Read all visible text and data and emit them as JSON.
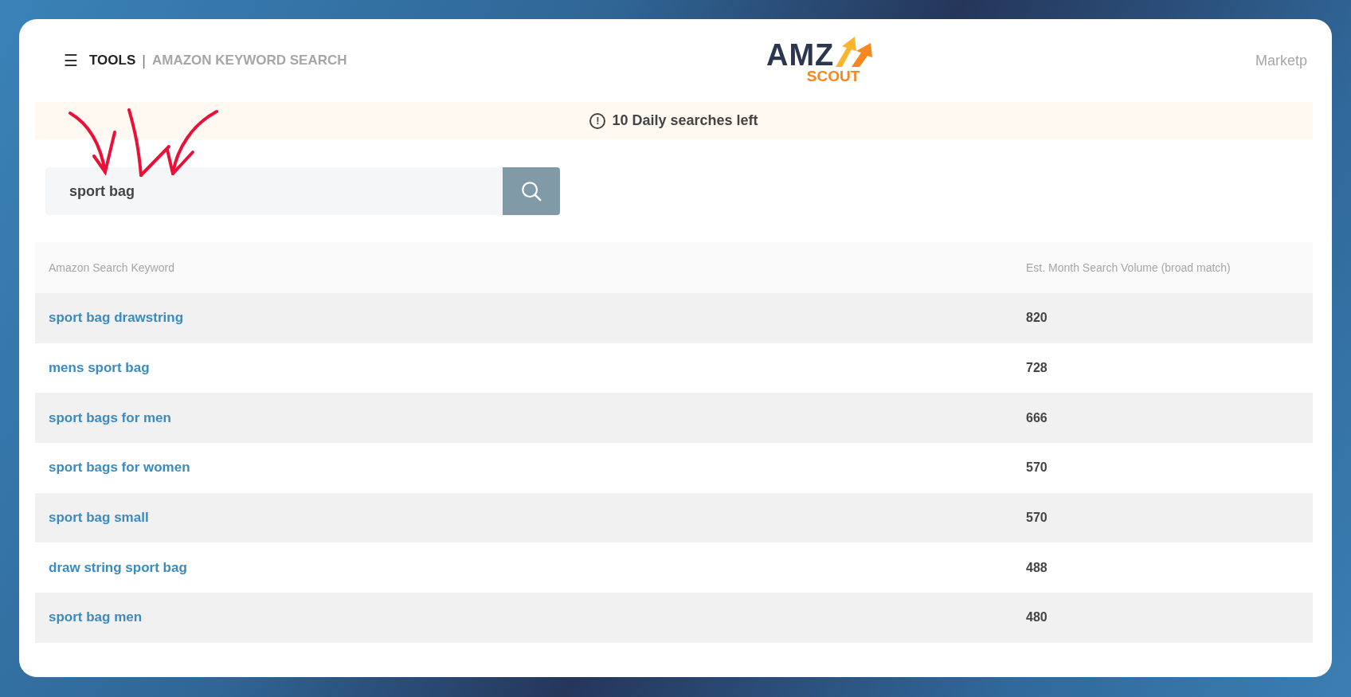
{
  "header": {
    "menu_icon": "☰",
    "section": "TOOLS",
    "separator": "|",
    "page": "AMAZON KEYWORD SEARCH",
    "logo": {
      "top": "AMZ",
      "bottom": "SCOUT"
    },
    "marketplace": "Marketp"
  },
  "notice": {
    "icon": "!",
    "text": "10 Daily searches left"
  },
  "search": {
    "value": "sport bag"
  },
  "table": {
    "columns": [
      "Amazon Search Keyword",
      "Est. Month Search Volume (broad match)"
    ],
    "rows": [
      {
        "keyword": "sport bag drawstring",
        "volume": "820"
      },
      {
        "keyword": "mens sport bag",
        "volume": "728"
      },
      {
        "keyword": "sport bags for men",
        "volume": "666"
      },
      {
        "keyword": "sport bags for women",
        "volume": "570"
      },
      {
        "keyword": "sport bag small",
        "volume": "570"
      },
      {
        "keyword": "draw string sport bag",
        "volume": "488"
      },
      {
        "keyword": "sport bag men",
        "volume": "480"
      }
    ]
  }
}
